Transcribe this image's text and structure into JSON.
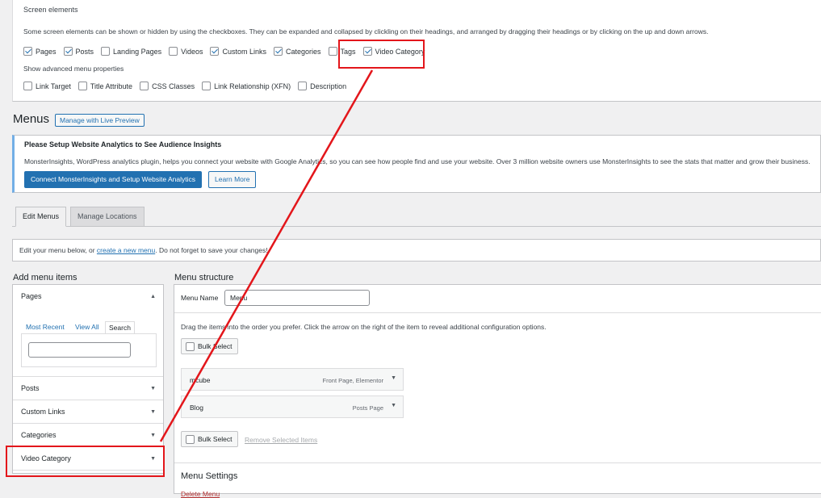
{
  "screen_options": {
    "heading": "Screen elements",
    "description": "Some screen elements can be shown or hidden by using the checkboxes. They can be expanded and collapsed by clickling on their headings, and arranged by dragging their headings or by clicking on the up and down arrows.",
    "elements": [
      {
        "label": "Pages",
        "checked": true
      },
      {
        "label": "Posts",
        "checked": true
      },
      {
        "label": "Landing Pages",
        "checked": false
      },
      {
        "label": "Videos",
        "checked": false
      },
      {
        "label": "Custom Links",
        "checked": true
      },
      {
        "label": "Categories",
        "checked": true
      },
      {
        "label": "Tags",
        "checked": false
      },
      {
        "label": "Video Category",
        "checked": true
      }
    ],
    "advanced_heading": "Show advanced menu properties",
    "advanced": [
      {
        "label": "Link Target",
        "checked": false
      },
      {
        "label": "Title Attribute",
        "checked": false
      },
      {
        "label": "CSS Classes",
        "checked": false
      },
      {
        "label": "Link Relationship (XFN)",
        "checked": false
      },
      {
        "label": "Description",
        "checked": false
      }
    ]
  },
  "page": {
    "title": "Menus",
    "live_preview": "Manage with Live Preview"
  },
  "notice": {
    "title": "Please Setup Website Analytics to See Audience Insights",
    "body": "MonsterInsights, WordPress analytics plugin, helps you connect your website with Google Analytics, so you can see how people find and use your website. Over 3 million website owners use MonsterInsights to see the stats that matter and grow their business.",
    "connect_button": "Connect MonsterInsights and Setup Website Analytics",
    "learn_button": "Learn More"
  },
  "tabs": {
    "edit": "Edit Menus",
    "locations": "Manage Locations"
  },
  "edit_bar": {
    "before": "Edit your menu below, or ",
    "link": "create a new menu",
    "after": ". Do not forget to save your changes!"
  },
  "add_items": {
    "title": "Add menu items",
    "pages": "Pages",
    "page_tabs": [
      "Most Recent",
      "View All",
      "Search"
    ],
    "sections": [
      "Posts",
      "Custom Links",
      "Categories",
      "Video Category"
    ]
  },
  "structure": {
    "title": "Menu structure",
    "name_label": "Menu Name",
    "name_value": "Menu",
    "drag_text": "Drag the items into the order you prefer. Click the arrow on the right of the item to reveal additional configuration options.",
    "bulk_select": "Bulk Select",
    "items": [
      {
        "title": "mcube",
        "type": "Front Page, Elementor"
      },
      {
        "title": "Blog",
        "type": "Posts Page"
      }
    ],
    "remove_selected": "Remove Selected Items",
    "settings_title": "Menu Settings",
    "delete_menu": "Delete Menu"
  },
  "annotation_color": "#e3161b"
}
